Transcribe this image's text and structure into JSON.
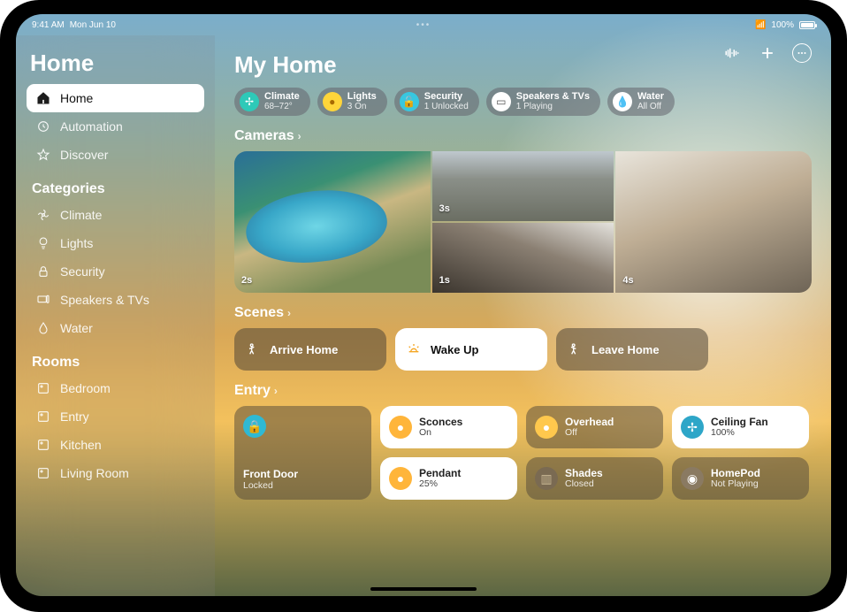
{
  "status": {
    "time": "9:41 AM",
    "date": "Mon Jun 10",
    "battery": "100%"
  },
  "sidebar": {
    "title": "Home",
    "nav": [
      {
        "label": "Home",
        "icon": "house-icon",
        "active": true
      },
      {
        "label": "Automation",
        "icon": "clock-icon",
        "active": false
      },
      {
        "label": "Discover",
        "icon": "star-icon",
        "active": false
      }
    ],
    "categories_header": "Categories",
    "categories": [
      {
        "label": "Climate",
        "icon": "fan-icon"
      },
      {
        "label": "Lights",
        "icon": "bulb-icon"
      },
      {
        "label": "Security",
        "icon": "lock-icon"
      },
      {
        "label": "Speakers & TVs",
        "icon": "tv-icon"
      },
      {
        "label": "Water",
        "icon": "drop-icon"
      }
    ],
    "rooms_header": "Rooms",
    "rooms": [
      {
        "label": "Bedroom",
        "icon": "room-icon"
      },
      {
        "label": "Entry",
        "icon": "room-icon"
      },
      {
        "label": "Kitchen",
        "icon": "room-icon"
      },
      {
        "label": "Living Room",
        "icon": "room-icon"
      }
    ]
  },
  "main": {
    "title": "My Home",
    "chips": [
      {
        "icon": "fan-icon",
        "color": "fan",
        "l1": "Climate",
        "l2": "68–72°"
      },
      {
        "icon": "bulb-icon",
        "color": "bulb",
        "l1": "Lights",
        "l2": "3 On"
      },
      {
        "icon": "lock-icon",
        "color": "lock",
        "l1": "Security",
        "l2": "1 Unlocked"
      },
      {
        "icon": "tv-icon",
        "color": "tv",
        "l1": "Speakers & TVs",
        "l2": "1 Playing"
      },
      {
        "icon": "drop-icon",
        "color": "drop",
        "l1": "Water",
        "l2": "All Off"
      }
    ],
    "cameras_header": "Cameras",
    "cameras": [
      {
        "timestamp": "2s"
      },
      {
        "timestamp": "3s"
      },
      {
        "timestamp": "1s"
      },
      {
        "timestamp": "4s"
      }
    ],
    "scenes_header": "Scenes",
    "scenes": [
      {
        "label": "Arrive Home",
        "icon": "person-arrive-icon",
        "active": false
      },
      {
        "label": "Wake Up",
        "icon": "sunrise-icon",
        "active": true
      },
      {
        "label": "Leave Home",
        "icon": "person-leave-icon",
        "active": false
      }
    ],
    "entry_header": "Entry",
    "entry_tiles": {
      "front_door": {
        "name": "Front Door",
        "state": "Locked",
        "icon": "lock-icon",
        "color": "lock"
      },
      "sconces": {
        "name": "Sconces",
        "state": "On",
        "icon": "bulb-icon",
        "color": "bulbOn",
        "bright": true
      },
      "overhead": {
        "name": "Overhead",
        "state": "Off",
        "icon": "bulb-icon",
        "color": "bulbOff",
        "bright": false
      },
      "ceiling_fan": {
        "name": "Ceiling Fan",
        "state": "100%",
        "icon": "fan-icon",
        "color": "fan",
        "bright": true
      },
      "pendant": {
        "name": "Pendant",
        "state": "25%",
        "icon": "bulb-icon",
        "color": "bulbOn",
        "bright": true
      },
      "shades": {
        "name": "Shades",
        "state": "Closed",
        "icon": "shades-icon",
        "color": "shade",
        "bright": false
      },
      "homepod": {
        "name": "HomePod",
        "state": "Not Playing",
        "icon": "homepod-icon",
        "color": "pod",
        "bright": false
      }
    }
  }
}
